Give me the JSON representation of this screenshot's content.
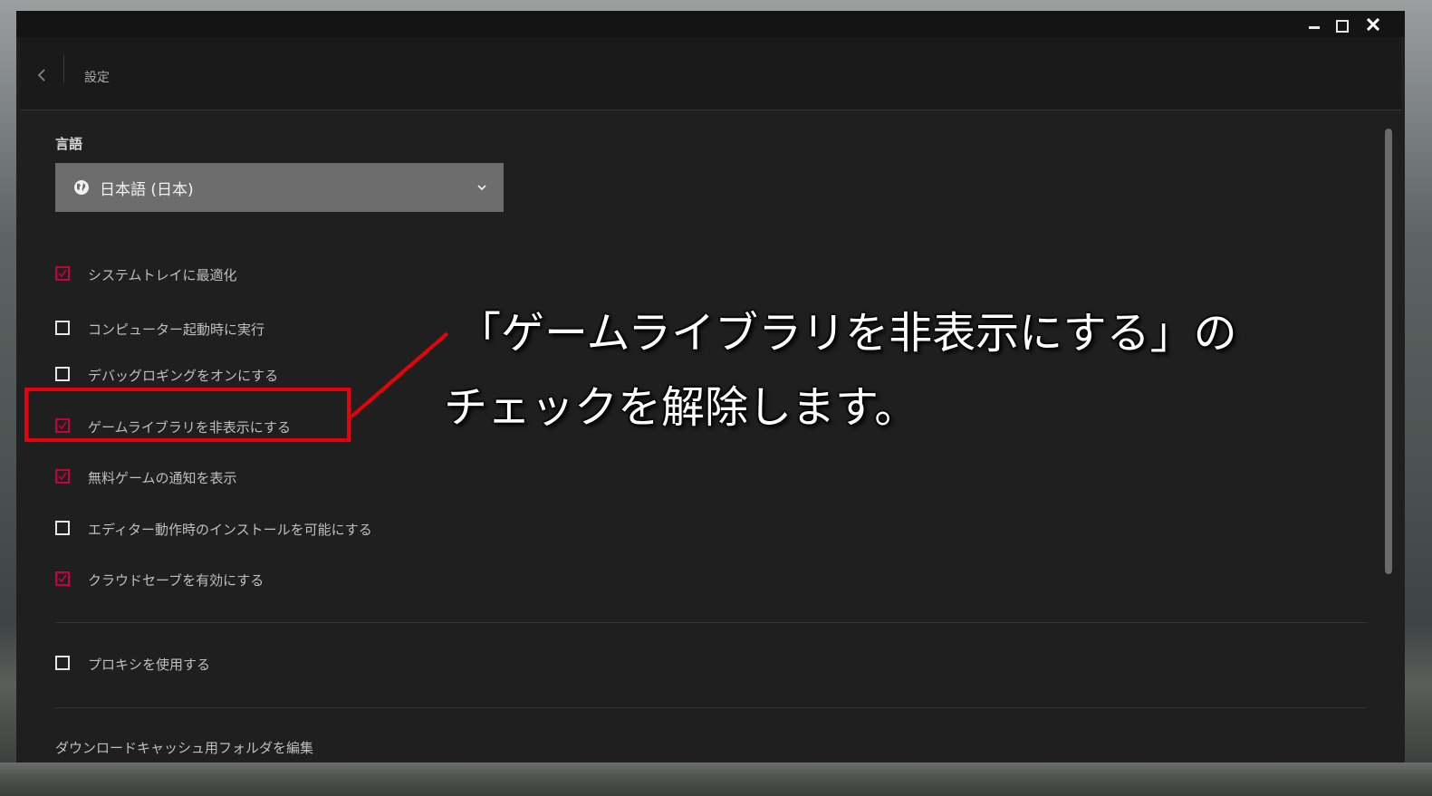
{
  "window": {
    "title_controls": [
      "minimize",
      "maximize",
      "close"
    ]
  },
  "header": {
    "title": "設定",
    "back_icon": "chevron-left-icon"
  },
  "language": {
    "label": "言語",
    "selected": "日本語 (日本)",
    "icon": "globe-icon"
  },
  "options": [
    {
      "label": "システムトレイに最適化",
      "checked": true
    },
    {
      "label": "コンピューター起動時に実行",
      "checked": false
    },
    {
      "label": "デバッグロギングをオンにする",
      "checked": false
    },
    {
      "label": "ゲームライブラリを非表示にする",
      "checked": true
    },
    {
      "label": "無料ゲームの通知を表示",
      "checked": true
    },
    {
      "label": "エディター動作時のインストールを可能にする",
      "checked": false
    },
    {
      "label": "クラウドセーブを有効にする",
      "checked": true
    }
  ],
  "proxy": {
    "label": "プロキシを使用する",
    "checked": false
  },
  "download_cache": {
    "label": "ダウンロードキャッシュ用フォルダを編集"
  },
  "annotation": {
    "line1": "「ゲームライブラリを非表示にする」の",
    "line2": "チェックを解除します。"
  },
  "colors": {
    "accent": "#c8003c",
    "highlight": "#e8000a",
    "background": "#1f1f1f"
  }
}
